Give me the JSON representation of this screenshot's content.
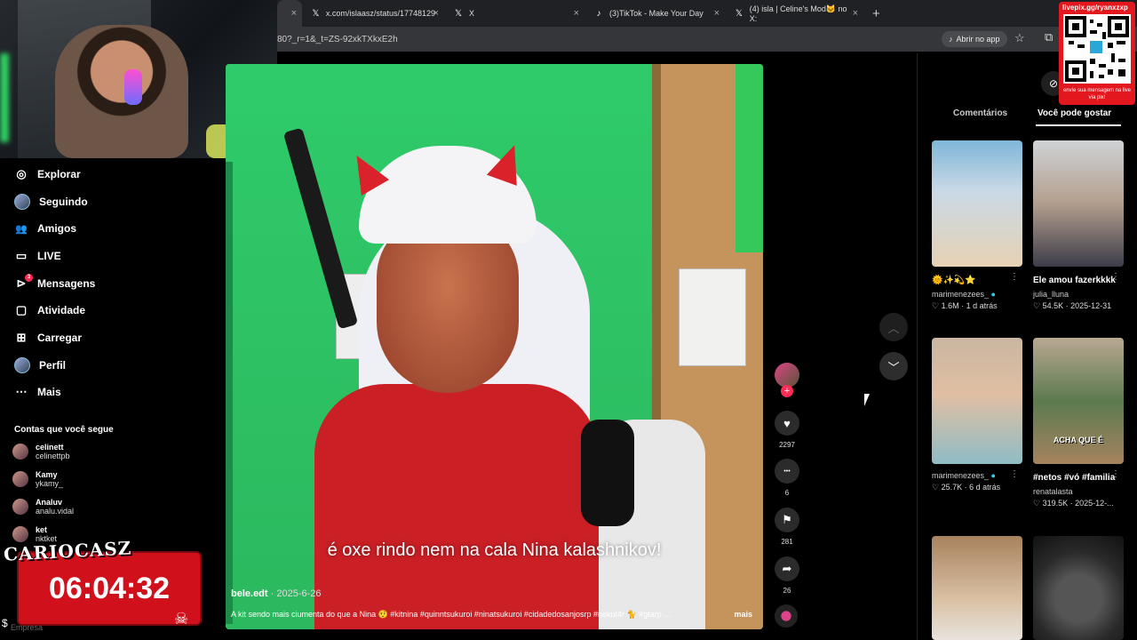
{
  "browser": {
    "tabs": [
      {
        "label": "",
        "icon": "page-icon"
      },
      {
        "label": "x.com/islaasz/status/17748129",
        "icon": "x-icon"
      },
      {
        "label": "X",
        "icon": "x-icon"
      },
      {
        "label": "(3)TikTok - Make Your Day",
        "icon": "tiktok-icon"
      },
      {
        "label": "(4) isla | Celine's Mod🐱 no X:",
        "icon": "x-icon"
      }
    ],
    "new_tab": "+",
    "url": "80?_r=1&_t=ZS-92xkTXkxE2h",
    "open_app": "Abrir no app",
    "tab_icon_x": "𝕏",
    "tab_icon_tiktok": "♪",
    "close": "×",
    "star": "☆",
    "extensions": "⧉"
  },
  "sidebar": {
    "items": [
      {
        "label": "Explorar",
        "icon": "compass-icon",
        "glyph": "◎"
      },
      {
        "label": "Seguindo",
        "icon": "avatar-icon",
        "glyph": ""
      },
      {
        "label": "Amigos",
        "icon": "friends-icon",
        "glyph": "👥"
      },
      {
        "label": "LIVE",
        "icon": "live-icon",
        "glyph": "▭"
      },
      {
        "label": "Mensagens",
        "icon": "messages-icon",
        "glyph": "⊳",
        "badge": "3"
      },
      {
        "label": "Atividade",
        "icon": "activity-icon",
        "glyph": "▢"
      },
      {
        "label": "Carregar",
        "icon": "upload-icon",
        "glyph": "⊞"
      },
      {
        "label": "Perfil",
        "icon": "profile-icon",
        "glyph": ""
      },
      {
        "label": "Mais",
        "icon": "more-icon",
        "glyph": "⋯"
      }
    ],
    "following_title": "Contas que você segue",
    "accounts": [
      {
        "name": "celinett",
        "handle": "celinettpb"
      },
      {
        "name": "Kamy",
        "handle": "ykamy_"
      },
      {
        "name": "Analuv",
        "handle": "analu.vidal"
      },
      {
        "name": "ket",
        "handle": "nktket"
      }
    ],
    "footer": "Empresa"
  },
  "overlay": {
    "name": "CARIOCASZ",
    "timer": "06:04:32",
    "dollar": "$",
    "skull": "☠"
  },
  "video": {
    "caption": "é oxe rindo nem na cala Nina kalashnikov!",
    "author": "bele.edt",
    "date": "· 2025-6-26",
    "description": "A kit sendo mais ciumenta do que a Nina 🤨 #kitnina #quinntsukuroi  #ninatsukuroi #cidadedosanjosrp #nekut4r 🐈 #gtarp ...",
    "more": "mais"
  },
  "actions": {
    "follow": "+",
    "likes": "2297",
    "comments": "6",
    "saves": "281",
    "shares": "26",
    "like_icon": "♥",
    "comment_icon": "•••",
    "save_icon": "⚑",
    "share_icon": "➦"
  },
  "nav": {
    "up": "︿",
    "down": "﹀"
  },
  "right_panel": {
    "tab_comments": "Comentários",
    "tab_liked": "Você pode gostar",
    "cards": [
      {
        "title": "🌞✨💫⭐",
        "author": "marimenezees_",
        "verified": true,
        "stats": "♡ 1.6M · 1 d atrás",
        "thumb_text": ""
      },
      {
        "title": "Ele amou fazerkkkk",
        "author": "julia_lluna",
        "verified": false,
        "stats": "♡ 54.5K · 2025-12-31",
        "thumb_text": ""
      },
      {
        "title": "",
        "author": "marimenezees_",
        "verified": true,
        "stats": "♡ 25.7K · 6 d atrás",
        "thumb_text": ""
      },
      {
        "title": "#netos #vó #familia",
        "author": "renatalasta",
        "verified": false,
        "stats": "♡ 319.5K · 2025-12-...",
        "thumb_text": "ACHA QUE É"
      },
      {
        "title": "",
        "author": "",
        "verified": false,
        "stats": "",
        "thumb_text": ""
      },
      {
        "title": "",
        "author": "",
        "verified": false,
        "stats": "",
        "thumb_text": ""
      }
    ],
    "kebab": "⋮",
    "verified_mark": "●"
  },
  "qr": {
    "top": "livepix.gg/ryanxzxp",
    "bottom": "envie sua mensagem na live via pix!"
  },
  "colors": {
    "accent": "#fe2c55",
    "timer": "#d0111b",
    "qr_bg": "#e3171e"
  }
}
